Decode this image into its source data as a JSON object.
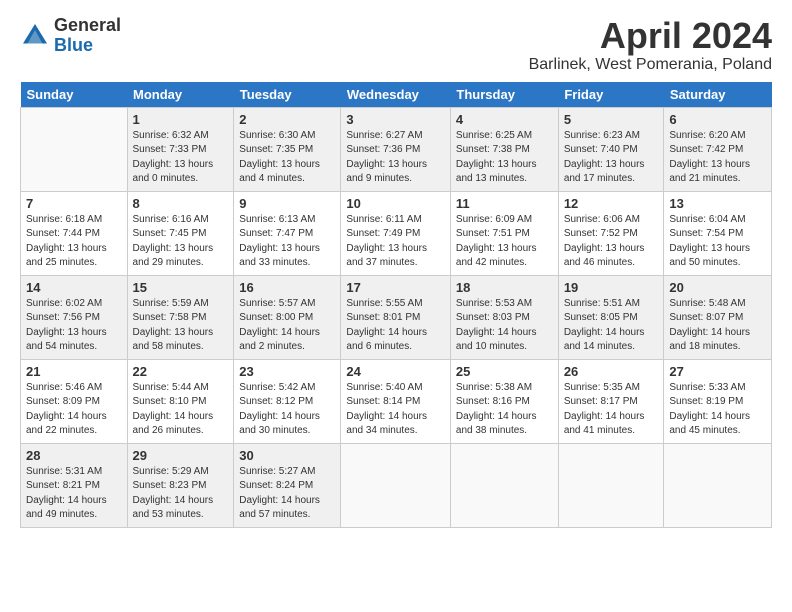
{
  "logo": {
    "general": "General",
    "blue": "Blue"
  },
  "title": "April 2024",
  "subtitle": "Barlinek, West Pomerania, Poland",
  "days_of_week": [
    "Sunday",
    "Monday",
    "Tuesday",
    "Wednesday",
    "Thursday",
    "Friday",
    "Saturday"
  ],
  "weeks": [
    [
      {
        "num": "",
        "sunrise": "",
        "sunset": "",
        "daylight": ""
      },
      {
        "num": "1",
        "sunrise": "Sunrise: 6:32 AM",
        "sunset": "Sunset: 7:33 PM",
        "daylight": "Daylight: 13 hours and 0 minutes."
      },
      {
        "num": "2",
        "sunrise": "Sunrise: 6:30 AM",
        "sunset": "Sunset: 7:35 PM",
        "daylight": "Daylight: 13 hours and 4 minutes."
      },
      {
        "num": "3",
        "sunrise": "Sunrise: 6:27 AM",
        "sunset": "Sunset: 7:36 PM",
        "daylight": "Daylight: 13 hours and 9 minutes."
      },
      {
        "num": "4",
        "sunrise": "Sunrise: 6:25 AM",
        "sunset": "Sunset: 7:38 PM",
        "daylight": "Daylight: 13 hours and 13 minutes."
      },
      {
        "num": "5",
        "sunrise": "Sunrise: 6:23 AM",
        "sunset": "Sunset: 7:40 PM",
        "daylight": "Daylight: 13 hours and 17 minutes."
      },
      {
        "num": "6",
        "sunrise": "Sunrise: 6:20 AM",
        "sunset": "Sunset: 7:42 PM",
        "daylight": "Daylight: 13 hours and 21 minutes."
      }
    ],
    [
      {
        "num": "7",
        "sunrise": "Sunrise: 6:18 AM",
        "sunset": "Sunset: 7:44 PM",
        "daylight": "Daylight: 13 hours and 25 minutes."
      },
      {
        "num": "8",
        "sunrise": "Sunrise: 6:16 AM",
        "sunset": "Sunset: 7:45 PM",
        "daylight": "Daylight: 13 hours and 29 minutes."
      },
      {
        "num": "9",
        "sunrise": "Sunrise: 6:13 AM",
        "sunset": "Sunset: 7:47 PM",
        "daylight": "Daylight: 13 hours and 33 minutes."
      },
      {
        "num": "10",
        "sunrise": "Sunrise: 6:11 AM",
        "sunset": "Sunset: 7:49 PM",
        "daylight": "Daylight: 13 hours and 37 minutes."
      },
      {
        "num": "11",
        "sunrise": "Sunrise: 6:09 AM",
        "sunset": "Sunset: 7:51 PM",
        "daylight": "Daylight: 13 hours and 42 minutes."
      },
      {
        "num": "12",
        "sunrise": "Sunrise: 6:06 AM",
        "sunset": "Sunset: 7:52 PM",
        "daylight": "Daylight: 13 hours and 46 minutes."
      },
      {
        "num": "13",
        "sunrise": "Sunrise: 6:04 AM",
        "sunset": "Sunset: 7:54 PM",
        "daylight": "Daylight: 13 hours and 50 minutes."
      }
    ],
    [
      {
        "num": "14",
        "sunrise": "Sunrise: 6:02 AM",
        "sunset": "Sunset: 7:56 PM",
        "daylight": "Daylight: 13 hours and 54 minutes."
      },
      {
        "num": "15",
        "sunrise": "Sunrise: 5:59 AM",
        "sunset": "Sunset: 7:58 PM",
        "daylight": "Daylight: 13 hours and 58 minutes."
      },
      {
        "num": "16",
        "sunrise": "Sunrise: 5:57 AM",
        "sunset": "Sunset: 8:00 PM",
        "daylight": "Daylight: 14 hours and 2 minutes."
      },
      {
        "num": "17",
        "sunrise": "Sunrise: 5:55 AM",
        "sunset": "Sunset: 8:01 PM",
        "daylight": "Daylight: 14 hours and 6 minutes."
      },
      {
        "num": "18",
        "sunrise": "Sunrise: 5:53 AM",
        "sunset": "Sunset: 8:03 PM",
        "daylight": "Daylight: 14 hours and 10 minutes."
      },
      {
        "num": "19",
        "sunrise": "Sunrise: 5:51 AM",
        "sunset": "Sunset: 8:05 PM",
        "daylight": "Daylight: 14 hours and 14 minutes."
      },
      {
        "num": "20",
        "sunrise": "Sunrise: 5:48 AM",
        "sunset": "Sunset: 8:07 PM",
        "daylight": "Daylight: 14 hours and 18 minutes."
      }
    ],
    [
      {
        "num": "21",
        "sunrise": "Sunrise: 5:46 AM",
        "sunset": "Sunset: 8:09 PM",
        "daylight": "Daylight: 14 hours and 22 minutes."
      },
      {
        "num": "22",
        "sunrise": "Sunrise: 5:44 AM",
        "sunset": "Sunset: 8:10 PM",
        "daylight": "Daylight: 14 hours and 26 minutes."
      },
      {
        "num": "23",
        "sunrise": "Sunrise: 5:42 AM",
        "sunset": "Sunset: 8:12 PM",
        "daylight": "Daylight: 14 hours and 30 minutes."
      },
      {
        "num": "24",
        "sunrise": "Sunrise: 5:40 AM",
        "sunset": "Sunset: 8:14 PM",
        "daylight": "Daylight: 14 hours and 34 minutes."
      },
      {
        "num": "25",
        "sunrise": "Sunrise: 5:38 AM",
        "sunset": "Sunset: 8:16 PM",
        "daylight": "Daylight: 14 hours and 38 minutes."
      },
      {
        "num": "26",
        "sunrise": "Sunrise: 5:35 AM",
        "sunset": "Sunset: 8:17 PM",
        "daylight": "Daylight: 14 hours and 41 minutes."
      },
      {
        "num": "27",
        "sunrise": "Sunrise: 5:33 AM",
        "sunset": "Sunset: 8:19 PM",
        "daylight": "Daylight: 14 hours and 45 minutes."
      }
    ],
    [
      {
        "num": "28",
        "sunrise": "Sunrise: 5:31 AM",
        "sunset": "Sunset: 8:21 PM",
        "daylight": "Daylight: 14 hours and 49 minutes."
      },
      {
        "num": "29",
        "sunrise": "Sunrise: 5:29 AM",
        "sunset": "Sunset: 8:23 PM",
        "daylight": "Daylight: 14 hours and 53 minutes."
      },
      {
        "num": "30",
        "sunrise": "Sunrise: 5:27 AM",
        "sunset": "Sunset: 8:24 PM",
        "daylight": "Daylight: 14 hours and 57 minutes."
      },
      {
        "num": "",
        "sunrise": "",
        "sunset": "",
        "daylight": ""
      },
      {
        "num": "",
        "sunrise": "",
        "sunset": "",
        "daylight": ""
      },
      {
        "num": "",
        "sunrise": "",
        "sunset": "",
        "daylight": ""
      },
      {
        "num": "",
        "sunrise": "",
        "sunset": "",
        "daylight": ""
      }
    ]
  ],
  "row_styles": [
    "shaded",
    "white",
    "shaded",
    "white",
    "shaded"
  ]
}
